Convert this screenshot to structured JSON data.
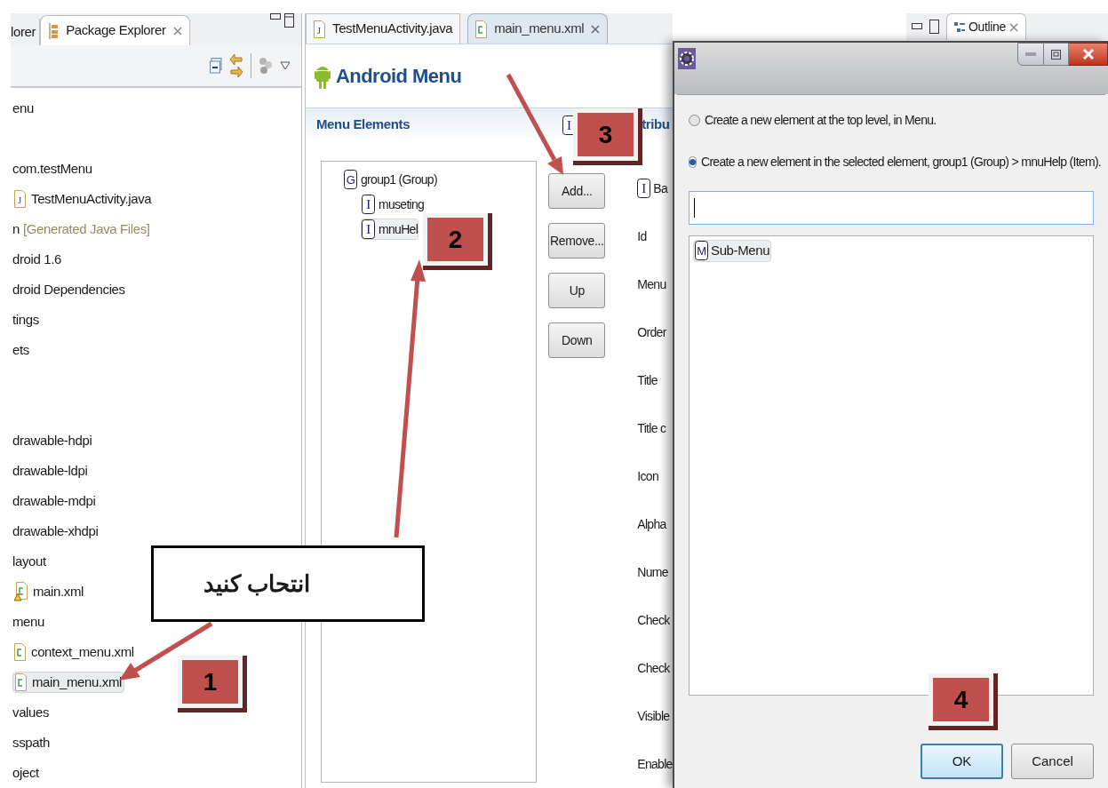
{
  "explorer": {
    "tabs": [
      {
        "label": "lorer",
        "selected": false
      },
      {
        "label": "Package Explorer",
        "selected": true
      }
    ],
    "sections": [
      [
        {
          "text": "enu",
          "kind": "folder",
          "selected": false
        }
      ],
      [
        {
          "text": "com.testMenu",
          "kind": "folder",
          "selected": false
        },
        {
          "text": "TestMenuActivity.java",
          "kind": "java",
          "badge": "J",
          "selected": false
        },
        {
          "text": "n",
          "decoration": "[Generated Java Files]",
          "kind": "folder",
          "selected": false
        },
        {
          "text": "droid 1.6",
          "kind": "folder",
          "selected": false
        },
        {
          "text": "droid Dependencies",
          "kind": "folder",
          "selected": false
        },
        {
          "text": "tings",
          "kind": "folder",
          "selected": false
        },
        {
          "text": "ets",
          "kind": "folder",
          "selected": false
        }
      ],
      [
        {
          "text": "drawable-hdpi",
          "kind": "folder",
          "selected": false
        },
        {
          "text": "drawable-ldpi",
          "kind": "folder",
          "selected": false
        },
        {
          "text": "drawable-mdpi",
          "kind": "folder",
          "selected": false
        },
        {
          "text": "drawable-xhdpi",
          "kind": "folder",
          "selected": false
        },
        {
          "text": "layout",
          "kind": "folder",
          "selected": false
        },
        {
          "text": "main.xml",
          "kind": "xmlwarning",
          "selected": false
        },
        {
          "text": "menu",
          "kind": "folder",
          "selected": false
        },
        {
          "text": "context_menu.xml",
          "kind": "xml",
          "selected": false
        },
        {
          "text": "main_menu.xml",
          "kind": "xml",
          "selected": true
        },
        {
          "text": "values",
          "kind": "folder",
          "selected": false
        },
        {
          "text": "sspath",
          "kind": "folder",
          "selected": false
        },
        {
          "text": "oject",
          "kind": "folder",
          "selected": false
        }
      ]
    ]
  },
  "editor": {
    "tabs": [
      {
        "label": "TestMenuActivity.java",
        "kind": "java",
        "badge": "J",
        "selected": false
      },
      {
        "label": "main_menu.xml",
        "kind": "xml",
        "selected": true
      }
    ],
    "title": "Android Menu",
    "section": "Menu Elements",
    "tree": [
      {
        "label": "group1 (Group)",
        "badge": "G",
        "selected": false,
        "children": [
          {
            "label": "museting",
            "badge": "I",
            "selected": false
          },
          {
            "label": "mnuHel",
            "badge": "I",
            "selected": true
          }
        ]
      }
    ],
    "buttons": [
      "Add...",
      "Remove...",
      "Up",
      "Down"
    ],
    "attributes_header": {
      "badge": "I",
      "label": "tribu"
    },
    "attributes": [
      {
        "label": "Ba",
        "badge": "I"
      },
      {
        "label": "Id"
      },
      {
        "label": "Menu"
      },
      {
        "label": "Order"
      },
      {
        "label": "Title"
      },
      {
        "label": "Title c"
      },
      {
        "label": "Icon"
      },
      {
        "label": "Alpha"
      },
      {
        "label": "Nume"
      },
      {
        "label": "Check"
      },
      {
        "label": "Check"
      },
      {
        "label": "Visible"
      },
      {
        "label": "Enable"
      }
    ]
  },
  "outline_tab": {
    "label": "Outline"
  },
  "dialog": {
    "options": [
      {
        "label": "Create a new element at the top level, in Menu.",
        "selected": false
      },
      {
        "label": "Create a new element in the selected element, group1 (Group) > mnuHelp (Item).",
        "selected": true
      }
    ],
    "list": [
      {
        "label": "Sub-Menu",
        "badge": "M",
        "selected": true
      }
    ],
    "buttons": [
      {
        "label": "OK",
        "default": true
      },
      {
        "label": "Cancel",
        "default": false
      }
    ]
  },
  "annotations": {
    "callout": "انتحاب کنید",
    "markers": [
      "1",
      "2",
      "3",
      "4"
    ]
  }
}
